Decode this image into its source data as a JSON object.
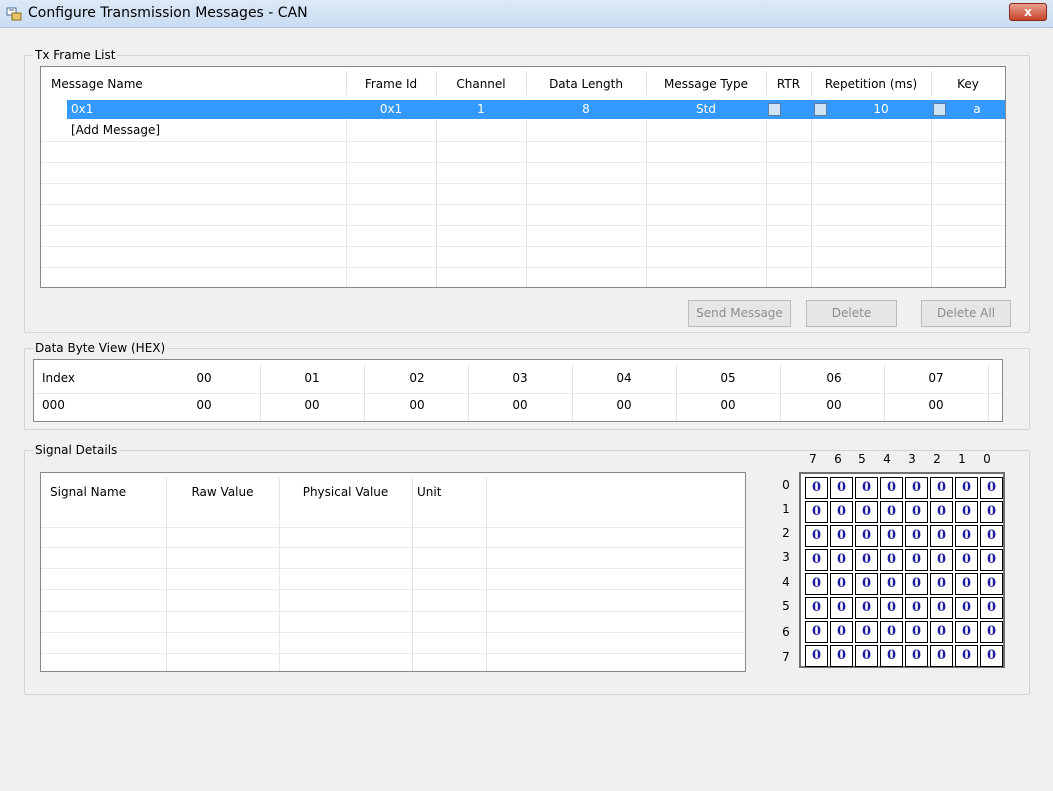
{
  "window": {
    "title": "Configure Transmission Messages - CAN",
    "close_label": "x"
  },
  "tx_frame_list": {
    "label": "Tx Frame List",
    "columns": [
      "Message Name",
      "Frame Id",
      "Channel",
      "Data Length",
      "Message Type",
      "RTR",
      "Repetition (ms)",
      "Key"
    ],
    "rows": [
      {
        "name": "0x1",
        "frame_id": "0x1",
        "channel": "1",
        "data_length": "8",
        "message_type": "Std",
        "rtr": false,
        "repetition": "10",
        "key_checked": false,
        "key": "a"
      }
    ],
    "add_message": "[Add Message]"
  },
  "buttons": {
    "send": "Send Message",
    "delete": "Delete",
    "delete_all": "Delete All"
  },
  "data_byte_view": {
    "label": "Data Byte View (HEX)",
    "headers": [
      "Index",
      "00",
      "01",
      "02",
      "03",
      "04",
      "05",
      "06",
      "07"
    ],
    "row": [
      "000",
      "00",
      "00",
      "00",
      "00",
      "00",
      "00",
      "00",
      "00"
    ]
  },
  "signal_details": {
    "label": "Signal Details",
    "columns": [
      "Signal Name",
      "Raw Value",
      "Physical Value",
      "Unit"
    ]
  },
  "bit_matrix": {
    "col_labels": [
      "7",
      "6",
      "5",
      "4",
      "3",
      "2",
      "1",
      "0"
    ],
    "row_labels": [
      "0",
      "1",
      "2",
      "3",
      "4",
      "5",
      "6",
      "7"
    ],
    "values": [
      [
        "0",
        "0",
        "0",
        "0",
        "0",
        "0",
        "0",
        "0"
      ],
      [
        "0",
        "0",
        "0",
        "0",
        "0",
        "0",
        "0",
        "0"
      ],
      [
        "0",
        "0",
        "0",
        "0",
        "0",
        "0",
        "0",
        "0"
      ],
      [
        "0",
        "0",
        "0",
        "0",
        "0",
        "0",
        "0",
        "0"
      ],
      [
        "0",
        "0",
        "0",
        "0",
        "0",
        "0",
        "0",
        "0"
      ],
      [
        "0",
        "0",
        "0",
        "0",
        "0",
        "0",
        "0",
        "0"
      ],
      [
        "0",
        "0",
        "0",
        "0",
        "0",
        "0",
        "0",
        "0"
      ],
      [
        "0",
        "0",
        "0",
        "0",
        "0",
        "0",
        "0",
        "0"
      ]
    ]
  },
  "colors": {
    "selection": "#3399ff",
    "bit_value": "#1a1a9e",
    "title_bar": "#dce9f7"
  }
}
